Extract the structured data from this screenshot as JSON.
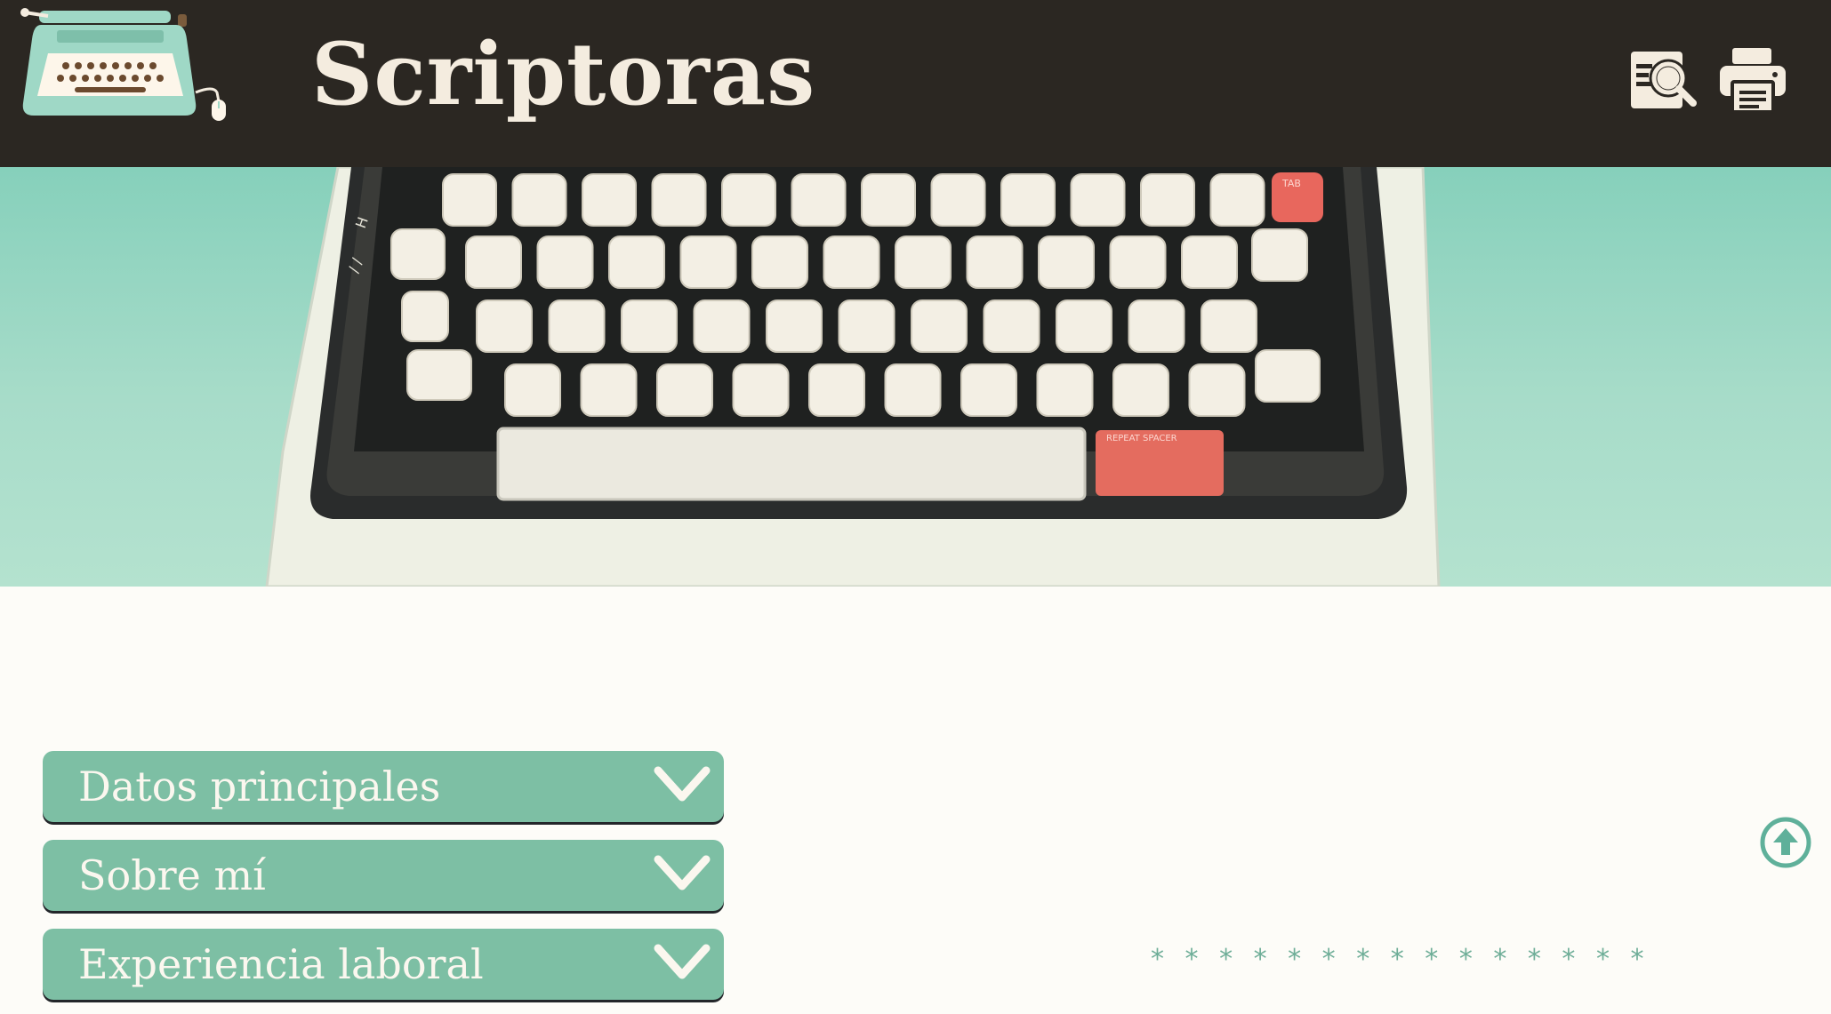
{
  "header": {
    "title": "Scriptoras",
    "logo_icon": "typewriter-logo-icon",
    "search_icon": "search-document-icon",
    "print_icon": "printer-icon",
    "background_color": "#2b2722",
    "title_color": "#f4ecdf"
  },
  "hero": {
    "image": "vintage-typewriter-keyboard",
    "background_color": "#a7dcc9"
  },
  "accordion": {
    "accent_color": "#7dbfa4",
    "items": [
      {
        "label": "Datos principales",
        "icon": "chevron-down-icon"
      },
      {
        "label": "Sobre mí",
        "icon": "chevron-down-icon"
      },
      {
        "label": "Experiencia laboral",
        "icon": "chevron-down-icon"
      }
    ]
  },
  "back_to_top_icon": "arrow-up-circle-icon",
  "divider": {
    "text": "* * * * * * * * * * * * * * *"
  }
}
